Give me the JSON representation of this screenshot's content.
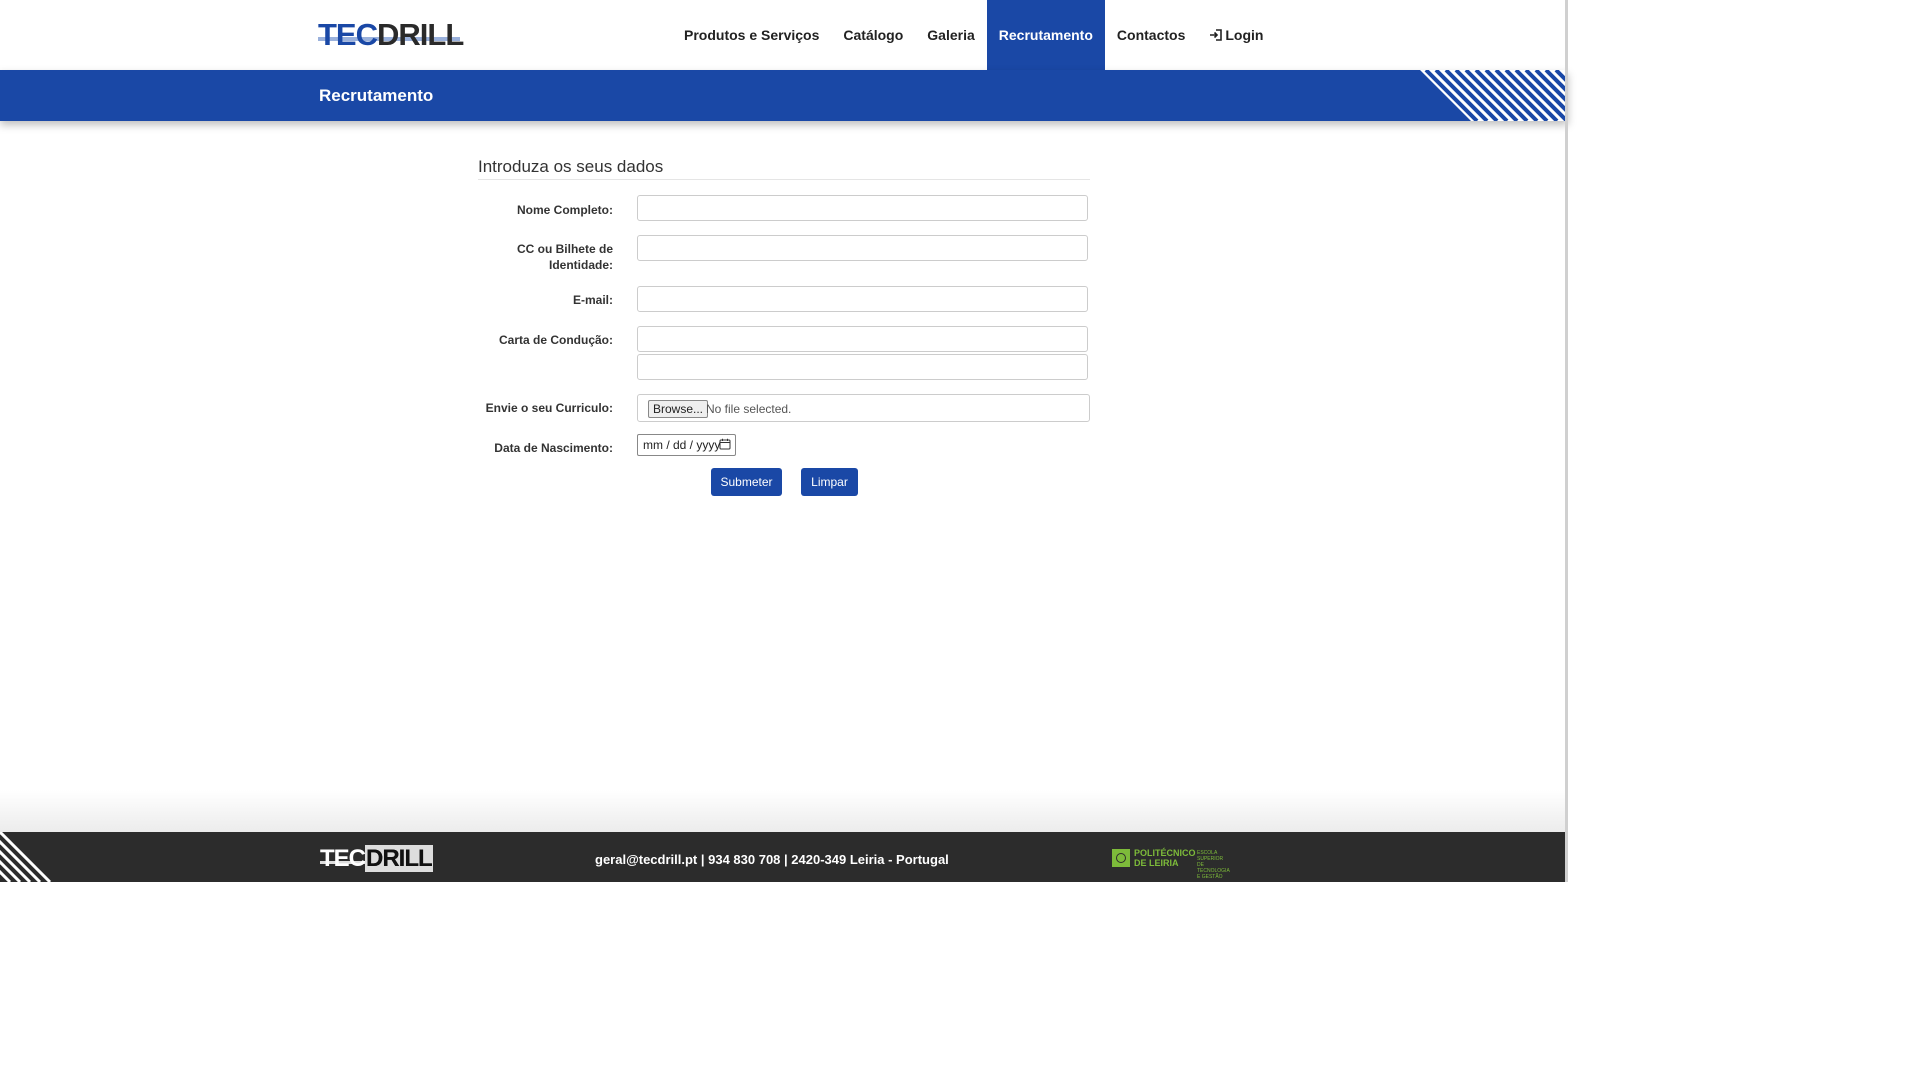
{
  "header": {
    "logo": {
      "part1": "TEC",
      "part2": "DRILL"
    },
    "nav": [
      {
        "label": "Produtos e Serviços",
        "active": false
      },
      {
        "label": "Catálogo",
        "active": false
      },
      {
        "label": "Galeria",
        "active": false
      },
      {
        "label": "Recrutamento",
        "active": true
      },
      {
        "label": "Contactos",
        "active": false
      },
      {
        "label": "Login",
        "active": false,
        "icon": "login-icon"
      }
    ]
  },
  "banner": {
    "title": "Recrutamento"
  },
  "form": {
    "heading": "Introduza os seus dados",
    "fields": {
      "nome": {
        "label": "Nome Completo:",
        "value": ""
      },
      "cc_line1": "CC ou Bilhete de",
      "cc_line2": "Identidade:",
      "cc_value": "",
      "email": {
        "label": "E-mail:",
        "value": ""
      },
      "carta": {
        "label": "Carta de Condução:",
        "value1": "",
        "value2": ""
      },
      "curriculo": {
        "label": "Envie o seu Curriculo:",
        "browse": "Browse...",
        "status": "No file selected."
      },
      "nascimento": {
        "label": "Data de Nascimento:",
        "placeholder": "mm / dd / yyyy",
        "icon": "calendar-icon"
      }
    },
    "buttons": {
      "submit": "Submeter",
      "reset": "Limpar"
    }
  },
  "footer": {
    "logo": {
      "part1": "TEC",
      "part2": "DRILL"
    },
    "contact": "geral@tecdrill.pt | 934 830 708 | 2420-349 Leiria - Portugal",
    "partner": {
      "line1": "POLITÉCNICO",
      "line2": "DE LEIRIA",
      "sub1": "ESCOLA SUPERIOR",
      "sub2": "DE TECNOLOGIA",
      "sub3": "E GESTÃO"
    }
  },
  "colors": {
    "brand_blue": "#1a48a6",
    "footer_bg": "#2c2c2c",
    "partner_green": "#7dbb3a"
  }
}
